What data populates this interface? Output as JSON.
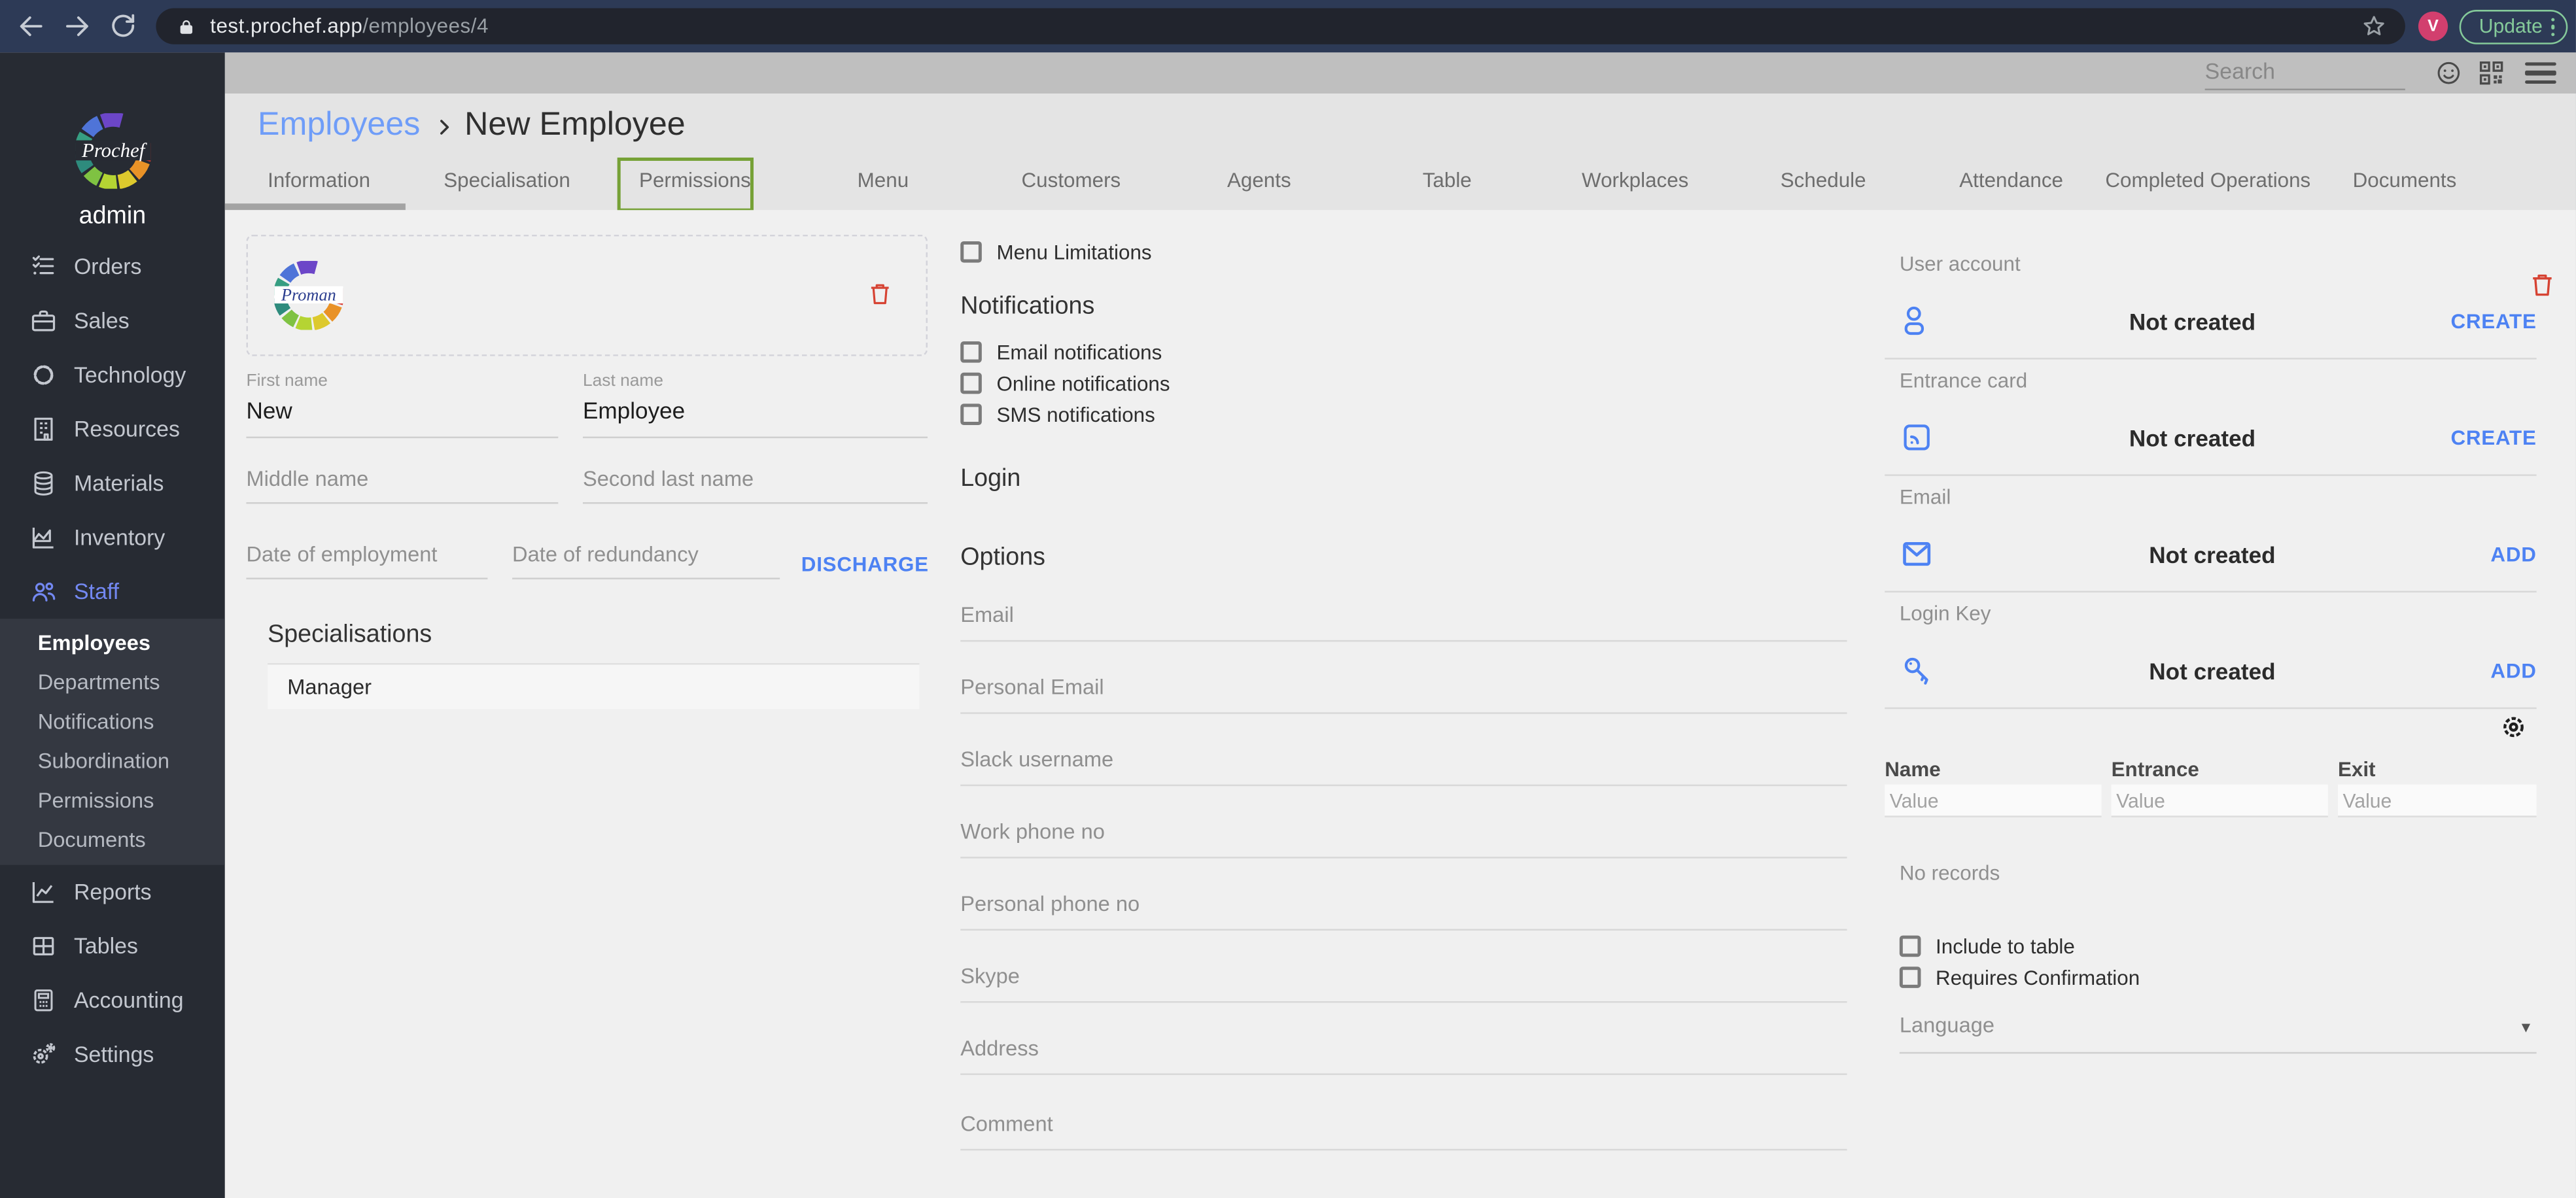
{
  "browser": {
    "url_host": "test.prochef.app",
    "url_path": "/employees/4",
    "avatar_letter": "V",
    "update_label": "Update"
  },
  "topbar": {
    "search_placeholder": "Search"
  },
  "sidebar": {
    "logo_text": "Prochef",
    "username": "admin",
    "items": [
      {
        "label": "Orders"
      },
      {
        "label": "Sales"
      },
      {
        "label": "Technology"
      },
      {
        "label": "Resources"
      },
      {
        "label": "Materials"
      },
      {
        "label": "Inventory"
      },
      {
        "label": "Staff"
      },
      {
        "label": "Reports"
      },
      {
        "label": "Tables"
      },
      {
        "label": "Accounting"
      },
      {
        "label": "Settings"
      }
    ],
    "staff_submenu": [
      {
        "label": "Employees"
      },
      {
        "label": "Departments"
      },
      {
        "label": "Notifications"
      },
      {
        "label": "Subordination"
      },
      {
        "label": "Permissions"
      },
      {
        "label": "Documents"
      }
    ]
  },
  "header": {
    "breadcrumb_parent": "Employees",
    "breadcrumb_current": "New Employee"
  },
  "tabs": {
    "items": [
      {
        "label": "Information"
      },
      {
        "label": "Specialisation"
      },
      {
        "label": "Permissions"
      },
      {
        "label": "Menu"
      },
      {
        "label": "Customers"
      },
      {
        "label": "Agents"
      },
      {
        "label": "Table"
      },
      {
        "label": "Workplaces"
      },
      {
        "label": "Schedule"
      },
      {
        "label": "Attendance"
      },
      {
        "label": "Completed Operations"
      },
      {
        "label": "Documents"
      }
    ]
  },
  "profile": {
    "avatar_logo_text": "Proman",
    "first_name": {
      "label": "First name",
      "value": "New"
    },
    "last_name": {
      "label": "Last name",
      "value": "Employee"
    },
    "middle_name_placeholder": "Middle name",
    "second_last_name_placeholder": "Second last name",
    "date_of_employment_placeholder": "Date of employment",
    "date_of_redundancy_placeholder": "Date of redundancy",
    "discharge_label": "DISCHARGE",
    "specialisations_title": "Specialisations",
    "specialisations": [
      {
        "name": "Manager"
      }
    ]
  },
  "middle": {
    "menu_limitations_label": "Menu Limitations",
    "notifications_title": "Notifications",
    "notification_options": [
      {
        "label": "Email notifications"
      },
      {
        "label": "Online notifications"
      },
      {
        "label": "SMS notifications"
      }
    ],
    "login_title": "Login",
    "options_title": "Options",
    "option_fields": [
      {
        "label": "Email"
      },
      {
        "label": "Personal Email"
      },
      {
        "label": "Slack username"
      },
      {
        "label": "Work phone no"
      },
      {
        "label": "Personal phone no"
      },
      {
        "label": "Skype"
      },
      {
        "label": "Address"
      },
      {
        "label": "Comment"
      }
    ]
  },
  "right": {
    "sections": [
      {
        "label": "User account",
        "status": "Not created",
        "action": "CREATE"
      },
      {
        "label": "Entrance card",
        "status": "Not created",
        "action": "CREATE"
      },
      {
        "label": "Email",
        "status": "Not created",
        "action": "ADD"
      },
      {
        "label": "Login Key",
        "status": "Not created",
        "action": "ADD"
      }
    ],
    "table": {
      "headers": [
        {
          "label": "Name"
        },
        {
          "label": "Entrance"
        },
        {
          "label": "Exit"
        }
      ],
      "filter_placeholder": "Value",
      "empty_text": "No records"
    },
    "checkboxes": [
      {
        "label": "Include to table"
      },
      {
        "label": "Requires Confirmation"
      }
    ],
    "language_placeholder": "Language"
  },
  "colors": {
    "accent_blue": "#4d82f3",
    "danger_red": "#d64333",
    "update_green": "#85ca9a",
    "avatar_pink": "#d23f6e",
    "active_blue": "#7388f2",
    "highlight_green": "#76a136",
    "sidebar_bg": "#272b33",
    "chrome_bg": "#2d3a56"
  }
}
